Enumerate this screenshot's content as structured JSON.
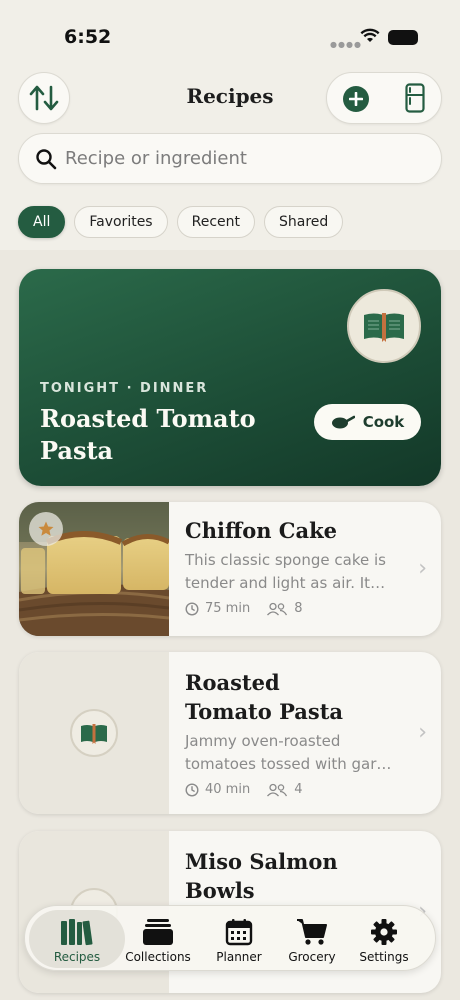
{
  "status": {
    "time": "6:52"
  },
  "header": {
    "title": "Recipes"
  },
  "search": {
    "placeholder": "Recipe or ingredient"
  },
  "filters": [
    "All",
    "Favorites",
    "Recent",
    "Shared"
  ],
  "hero": {
    "eyebrow": "TONIGHT · DINNER",
    "title": "Roasted Tomato Pasta",
    "cook_label": "Cook"
  },
  "recipes": [
    {
      "title": "Chiffon Cake",
      "description": "This classic sponge cake is tender and light as air. It…",
      "time": "75 min",
      "servings": "8",
      "favorite": true
    },
    {
      "title": "Roasted Tomato Pasta",
      "description": "Jammy oven-roasted tomatoes tossed with gar…",
      "time": "40 min",
      "servings": "4"
    },
    {
      "title": "Miso Salmon Bowls"
    }
  ],
  "tabs": [
    "Recipes",
    "Collections",
    "Planner",
    "Grocery",
    "Settings"
  ],
  "colors": {
    "accent": "#245c41",
    "background": "#f1efe8"
  },
  "icons": [
    "sort-icon",
    "add-icon",
    "fridge-icon",
    "search-icon",
    "book-icon",
    "pan-icon",
    "star-icon",
    "clock-icon",
    "people-icon",
    "chevron-right-icon"
  ]
}
